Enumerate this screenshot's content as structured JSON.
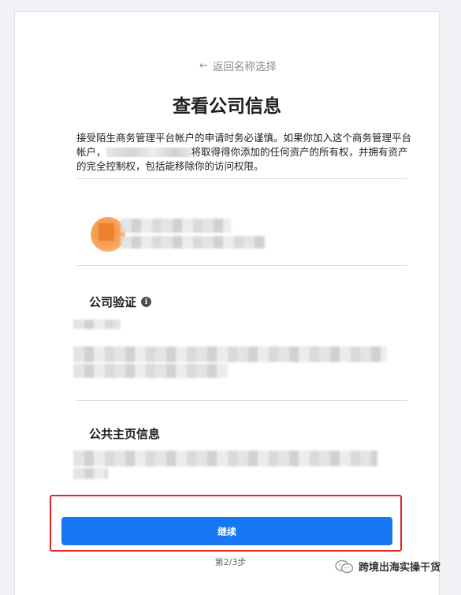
{
  "back_link": {
    "arrow": "←",
    "label": "返回名称选择"
  },
  "title": "查看公司信息",
  "description": {
    "part1": "接受陌生商务管理平台帐户的申请时务必谨慎。如果你加入这个商务管理平台帐户，",
    "part2": "将取得得你添加的任何资产的所有权，并拥有资产的完全控制权，包括能移除你的访问权限。"
  },
  "verification": {
    "title": "公司验证",
    "info_icon": "i"
  },
  "page_info": {
    "title": "公共主页信息"
  },
  "continue_button": {
    "label": "继续"
  },
  "step": "第2/3步",
  "watermark": {
    "text": "跨境出海实操干货"
  },
  "colors": {
    "primary": "#1877f2",
    "highlight": "#e0262b",
    "avatar": "#f08a2c"
  }
}
